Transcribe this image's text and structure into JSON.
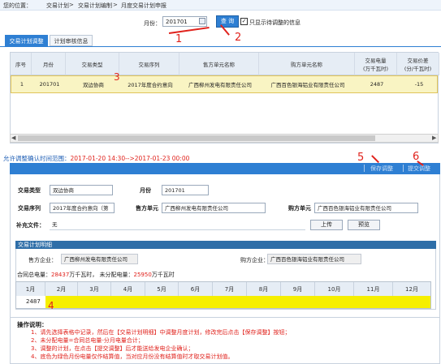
{
  "breadcrumb": {
    "location_label": "您的位置：",
    "items": [
      "交易计划",
      ">",
      "交易计划编制",
      ">",
      "月度交易计划申报"
    ]
  },
  "filter": {
    "month_label": "月份：",
    "month_value": "201701",
    "query_label": "查 询",
    "only_pending_label": "只显示待调整的信息"
  },
  "annotations": [
    "1",
    "2",
    "3",
    "4",
    "5",
    "6"
  ],
  "tabs": [
    {
      "label": "交易计划调整",
      "active": true
    },
    {
      "label": "计划审核信息",
      "active": false
    }
  ],
  "table": {
    "headers": [
      "序号",
      "月份",
      "交易类型",
      "交易序列",
      "售方单元名称",
      "购方单元名称",
      "交易电量\n(万千瓦时)",
      "交易价差\n(分/千瓦时)"
    ],
    "rows": [
      [
        "1",
        "201701",
        "双边协商",
        "2017年度合约意向",
        "广西柳州发电有限责任公司",
        "广西百色银海铝业有限责任公司",
        "2487",
        "-15"
      ]
    ]
  },
  "range": {
    "label": "允许调整确认时间范围：",
    "value": "2017-01-20 14:30-->2017-01-23 00:00"
  },
  "toolbar": {
    "save_label": "保存调整",
    "submit_label": "提交调整"
  },
  "form": {
    "trade_type_label": "交易类型",
    "trade_type_value": "双边协商",
    "month_label": "月份",
    "month_value": "201701",
    "trade_seq_label": "交易序列",
    "trade_seq_value": "2017年度合约意向（第",
    "seller_label": "售方单元",
    "seller_value": "广西柳州发电有限责任公司",
    "buyer_label": "购方单元",
    "buyer_value": "广西百色银海铝业有限责任公司",
    "attach_label": "补充文件：",
    "attach_value": "无",
    "upload_label": "上传",
    "preview_label": "预览"
  },
  "detail": {
    "title": "交易计划明细",
    "seller_label": "售方企业：",
    "seller_value": "广西柳州发电有限责任公司",
    "buyer_label": "购方企业：",
    "buyer_value": "广西百色银海铝业有限责任公司",
    "contract_label": "合同总电量：",
    "contract_value": "28437",
    "unit1": "万千瓦时，",
    "unallocated_label": "未分配电量：",
    "unallocated_value": "25950",
    "unit2": "万千瓦时",
    "months": [
      "1月",
      "2月",
      "3月",
      "4月",
      "5月",
      "6月",
      "7月",
      "8月",
      "9月",
      "10月",
      "11月",
      "12月"
    ],
    "month_values": [
      "2487",
      "",
      "",
      "",
      "",
      "",
      "",
      "",
      "",
      "",
      "",
      ""
    ]
  },
  "notes": {
    "title": "操作说明：",
    "items": [
      "1、请先选择表格中记录，然后在【交易计划明细】中调整月度计划，修改完后点击【保存调整】按钮；",
      "2、未分配电量=合同总电量-分月电量合计；",
      "3、调整的计划，在点击【提交调整】后才能送给发电企业确认；",
      "4、底色为绿色月份电量仅作结算值，当对应月份没有结算值时才取交易计划值。"
    ]
  },
  "colors": {
    "primary": "#2e7fd3",
    "annotation": "#e0221c",
    "selected_row": "#f9f4c3",
    "editable_cell": "#f6ef00"
  }
}
